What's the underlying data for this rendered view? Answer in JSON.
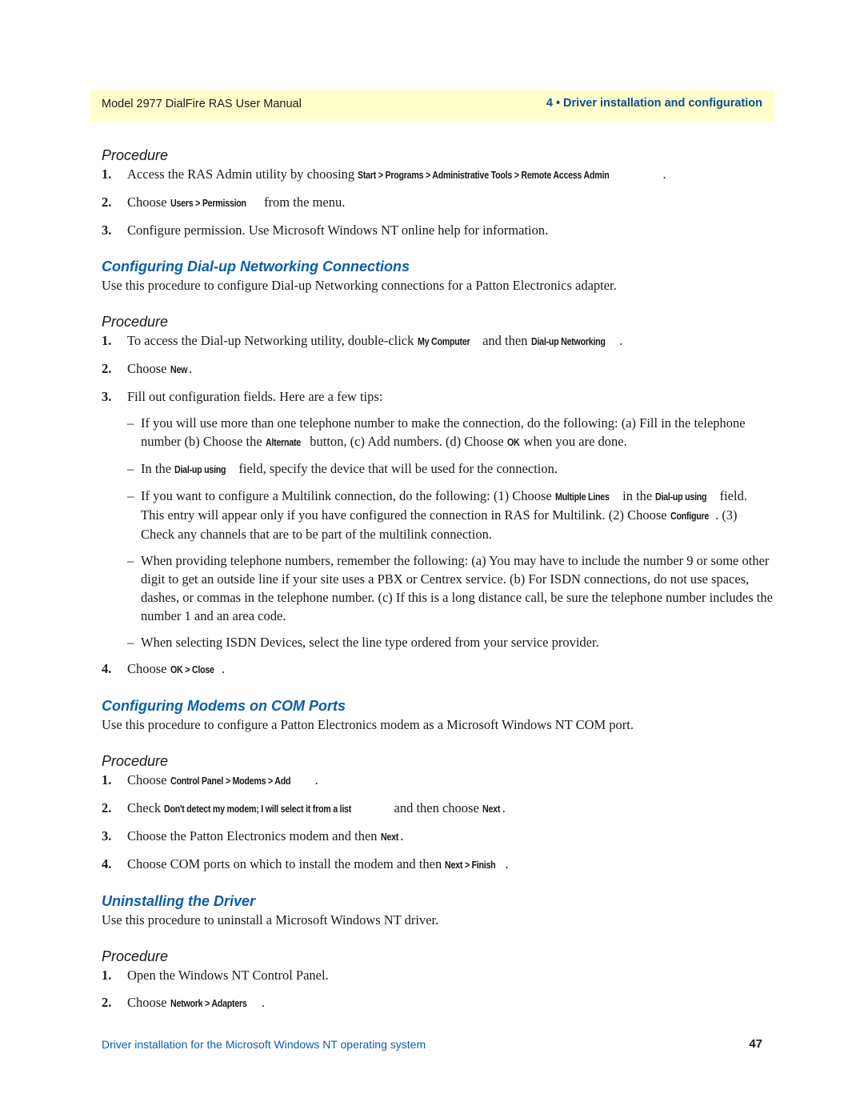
{
  "header": {
    "left": "Model 2977 DialFire RAS User Manual",
    "right": "4 • Driver installation and configuration"
  },
  "procedure_label": "Procedure",
  "section0": {
    "steps": [
      {
        "num": "1.",
        "parts": [
          {
            "t": "Access the RAS Admin utility by choosing "
          },
          {
            "b": "Start > Programs > Administrative Tools > Remote Access Admin"
          },
          {
            "t": "."
          }
        ]
      },
      {
        "num": "2.",
        "parts": [
          {
            "t": "Choose "
          },
          {
            "b": "Users > Permission"
          },
          {
            "t": " from the menu."
          }
        ]
      },
      {
        "num": "3.",
        "parts": [
          {
            "t": "Configure permission. Use Microsoft Windows NT online help for information."
          }
        ]
      }
    ]
  },
  "section1": {
    "title": "Configuring Dial-up Networking Connections",
    "intro": "Use this procedure to configure Dial-up Networking connections for a Patton Electronics adapter.",
    "steps_a": [
      {
        "num": "1.",
        "parts": [
          {
            "t": "To access the Dial-up Networking utility, double-click "
          },
          {
            "b": "My Computer"
          },
          {
            "t": " and then "
          },
          {
            "b": "Dial-up Networking"
          },
          {
            "t": "."
          }
        ]
      },
      {
        "num": "2.",
        "parts": [
          {
            "t": "Choose "
          },
          {
            "b": "New"
          },
          {
            "t": "."
          }
        ]
      },
      {
        "num": "3.",
        "parts": [
          {
            "t": "Fill out configuration fields. Here are a few tips:"
          }
        ]
      }
    ],
    "tips": [
      {
        "parts": [
          {
            "t": "If you will use more than one telephone number to make the connection, do the following: (a) Fill in the telephone number (b) Choose the "
          },
          {
            "b": "Alternate"
          },
          {
            "t": " button, (c) Add numbers. (d) Choose "
          },
          {
            "b": "OK"
          },
          {
            "t": " when you are done."
          }
        ]
      },
      {
        "parts": [
          {
            "t": "In the "
          },
          {
            "b": "Dial-up using"
          },
          {
            "t": " field, specify the device that will be used for the connection."
          }
        ]
      },
      {
        "parts": [
          {
            "t": "If you want to configure a Multilink connection, do the following: (1) Choose "
          },
          {
            "b": "Multiple Lines"
          },
          {
            "t": " in the "
          },
          {
            "b": "Dial-up using"
          },
          {
            "t": " field. This entry will appear only if you have configured the connection in RAS for Multilink. (2) Choose "
          },
          {
            "b": "Configure"
          },
          {
            "t": ". (3) Check any channels that are to be part of the multilink connection."
          }
        ]
      },
      {
        "parts": [
          {
            "t": "When providing telephone numbers, remember the following: (a) You may have to include the number 9 or some other digit to get an outside line if your site uses a PBX or Centrex service. (b) For ISDN connections, do not use spaces, dashes, or commas in the telephone number. (c) If this is a long distance call, be sure the telephone number includes the number 1 and an area code."
          }
        ]
      },
      {
        "parts": [
          {
            "t": "When selecting ISDN Devices, select the line type ordered from your service provider."
          }
        ]
      }
    ],
    "steps_b": [
      {
        "num": "4.",
        "parts": [
          {
            "t": "Choose "
          },
          {
            "b": "OK > Close"
          },
          {
            "t": "."
          }
        ]
      }
    ]
  },
  "section2": {
    "title": "Configuring Modems on COM Ports",
    "intro": "Use this procedure to configure a Patton Electronics modem as a Microsoft Windows NT COM port.",
    "steps": [
      {
        "num": "1.",
        "parts": [
          {
            "t": "Choose "
          },
          {
            "b": "Control Panel > Modems > Add"
          },
          {
            "t": "."
          }
        ]
      },
      {
        "num": "2.",
        "parts": [
          {
            "t": "Check "
          },
          {
            "b": "Don't detect my modem; I will select it from a list"
          },
          {
            "t": " and then choose "
          },
          {
            "b": "Next"
          },
          {
            "t": "."
          }
        ]
      },
      {
        "num": "3.",
        "parts": [
          {
            "t": "Choose the Patton Electronics modem and then "
          },
          {
            "b": "Next"
          },
          {
            "t": "."
          }
        ]
      },
      {
        "num": "4.",
        "parts": [
          {
            "t": "Choose COM ports on which to install the modem and then "
          },
          {
            "b": "Next > Finish"
          },
          {
            "t": "."
          }
        ]
      }
    ]
  },
  "section3": {
    "title": "Uninstalling the Driver",
    "intro": "Use this procedure to uninstall a Microsoft Windows NT driver.",
    "steps": [
      {
        "num": "1.",
        "parts": [
          {
            "t": "Open the Windows NT Control Panel."
          }
        ]
      },
      {
        "num": "2.",
        "parts": [
          {
            "t": "Choose "
          },
          {
            "b": "Network > Adapters"
          },
          {
            "t": "."
          }
        ]
      }
    ]
  },
  "footer": {
    "left": "Driver installation for the Microsoft Windows NT operating system",
    "page_number": "47"
  },
  "colors": {
    "header_bg": "#ffffcc",
    "accent_blue": "#0b5ea8",
    "header_blue": "#0b4f8c",
    "text": "#1a1a1a"
  }
}
